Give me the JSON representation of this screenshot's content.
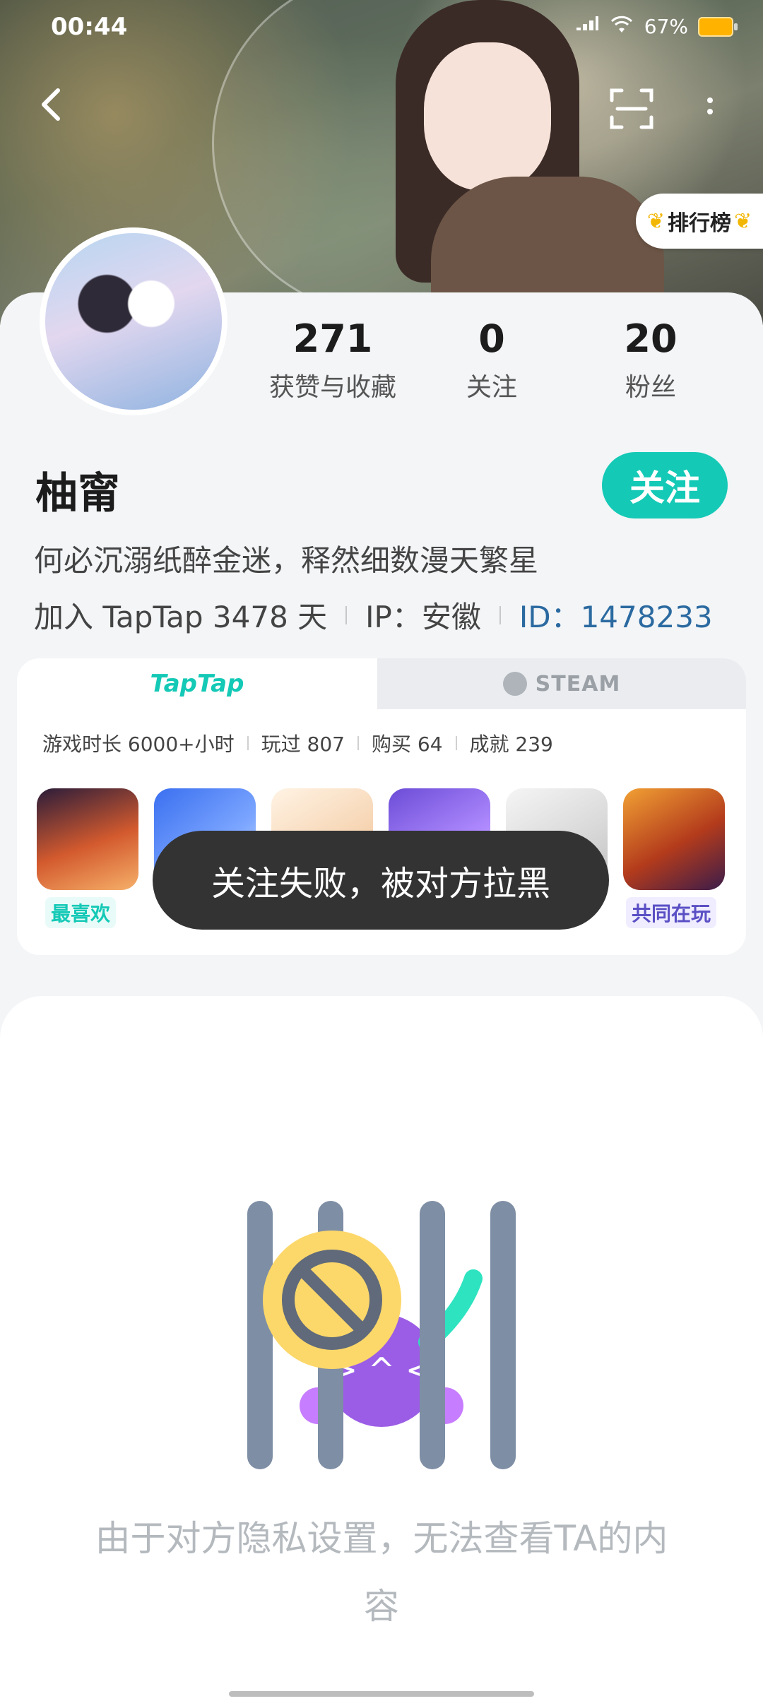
{
  "status_bar": {
    "time": "00:44",
    "battery_percent": "67%",
    "icons": [
      "signal-icon",
      "wifi-icon",
      "battery-icon"
    ]
  },
  "header": {
    "rank_label": "排行榜",
    "icons": [
      "back-icon",
      "scan-icon",
      "more-icon"
    ]
  },
  "profile": {
    "name": "柚甯",
    "follow_button": "关注",
    "bio": "何必沉溺纸醉金迷，释然细数漫天繁星",
    "joined": "加入 TapTap 3478 天",
    "ip": "IP：安徽",
    "id": "ID：1478233",
    "stats": [
      {
        "value": "271",
        "label": "获赞与收藏"
      },
      {
        "value": "0",
        "label": "关注"
      },
      {
        "value": "20",
        "label": "粉丝"
      }
    ]
  },
  "games": {
    "tabs": [
      {
        "label": "TapTap",
        "active": true
      },
      {
        "label": "STEAM",
        "active": false
      }
    ],
    "stats": [
      "游戏时长 6000+小时",
      "玩过 807",
      "购买 64",
      "成就 239"
    ],
    "tiles": [
      {
        "name": "game-tile-sky",
        "label": "最喜欢",
        "color": "#14c9b6"
      },
      {
        "name": "game-tile-2",
        "label": "",
        "color": ""
      },
      {
        "name": "game-tile-3",
        "label": "",
        "color": ""
      },
      {
        "name": "game-tile-4",
        "label": "",
        "color": ""
      },
      {
        "name": "game-tile-5",
        "label": "",
        "color": ""
      },
      {
        "name": "game-tile-honor-of-kings",
        "label": "共同在玩",
        "color": "#5a4fc4"
      }
    ]
  },
  "toast": {
    "message": "关注失败，被对方拉黑"
  },
  "privacy": {
    "message": "由于对方隐私设置，无法查看TA的内容"
  },
  "colors": {
    "accent": "#14c9b6",
    "id_link": "#2b6aa0",
    "toast_bg": "#333333"
  }
}
